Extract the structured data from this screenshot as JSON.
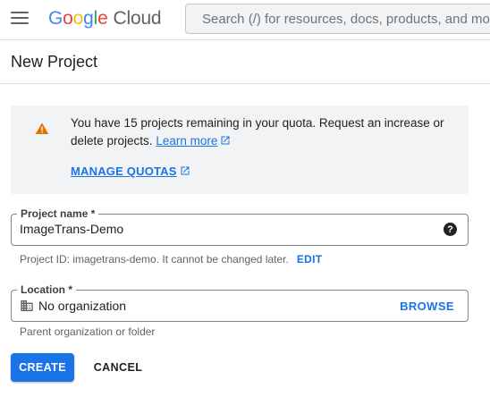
{
  "header": {
    "logo_letters": [
      "G",
      "o",
      "o",
      "g",
      "l",
      "e"
    ],
    "logo_suffix": "Cloud",
    "search_placeholder": "Search (/) for resources, docs, products, and mo"
  },
  "page": {
    "title": "New Project"
  },
  "quota_notice": {
    "message": "You have 15 projects remaining in your quota. Request an increase or delete projects.",
    "learn_more_label": "Learn more",
    "manage_quotas_label": "MANAGE QUOTAS",
    "icon": "warning-icon",
    "icon_color": "#e37400"
  },
  "project_name_field": {
    "label": "Project name *",
    "value": "ImageTrans-Demo",
    "help_icon": "help-icon"
  },
  "project_id_hint": {
    "text": "Project ID: imagetrans-demo. It cannot be changed later.",
    "edit_label": "EDIT"
  },
  "location_field": {
    "label": "Location *",
    "value": "No organization",
    "icon": "building-icon",
    "browse_label": "BROWSE"
  },
  "location_hint": "Parent organization or folder",
  "actions": {
    "create_label": "CREATE",
    "cancel_label": "CANCEL"
  },
  "colors": {
    "accent": "#1a73e8",
    "notice_background": "#f1f3f4"
  }
}
